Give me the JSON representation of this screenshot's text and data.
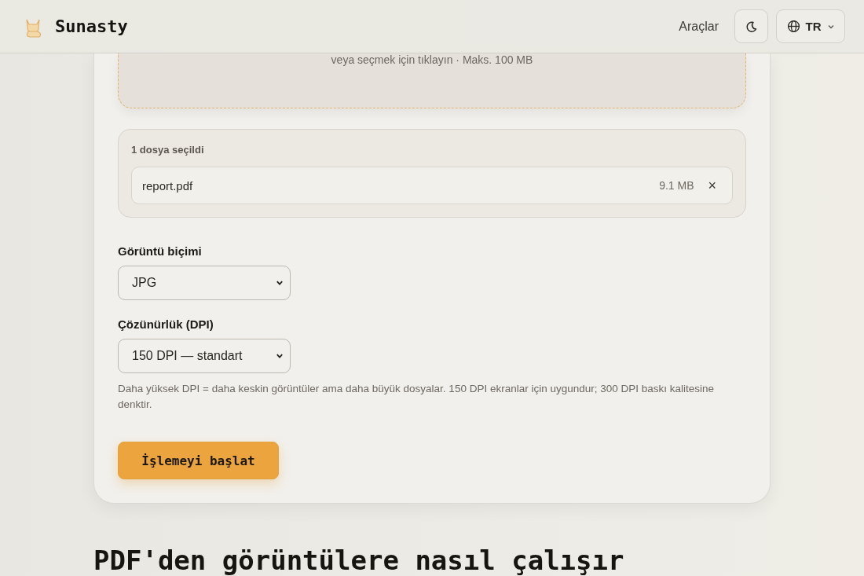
{
  "header": {
    "brand": "Sunasty",
    "nav_link": "Araçlar",
    "language": "TR"
  },
  "dropzone": {
    "hint": "veya seçmek için tıklayın · Maks. 100 MB"
  },
  "selected_files": {
    "title": "1 dosya seçildi",
    "files": [
      {
        "name": "report.pdf",
        "size": "9.1 MB",
        "remove": "×"
      }
    ]
  },
  "fields": [
    {
      "label": "Görüntü biçimi",
      "value": "JPG"
    },
    {
      "label": "Çözünürlük (DPI)",
      "value": "150 DPI — standart",
      "help": "Daha yüksek DPI = daha keskin görüntüler ama daha büyük dosyalar. 150 DPI ekranlar için uygundur; 300 DPI baskı kalitesine denktir."
    }
  ],
  "start_button": "İşlemeyi başlat",
  "section_heading": "PDF'den görüntülere nasıl çalışır"
}
